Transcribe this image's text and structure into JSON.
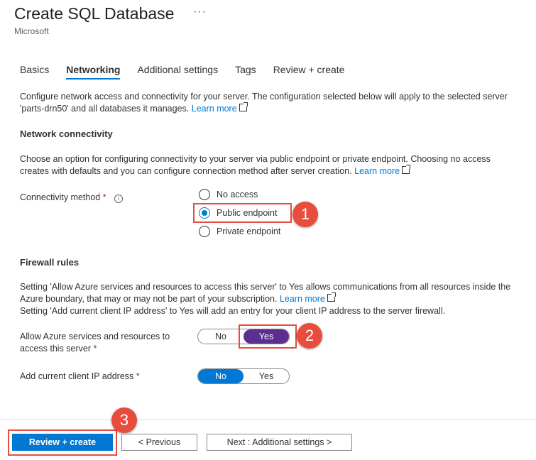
{
  "header": {
    "title": "Create SQL Database",
    "more": "···",
    "subtitle": "Microsoft"
  },
  "tabs": [
    {
      "label": "Basics",
      "active": false
    },
    {
      "label": "Networking",
      "active": true
    },
    {
      "label": "Additional settings",
      "active": false
    },
    {
      "label": "Tags",
      "active": false
    },
    {
      "label": "Review + create",
      "active": false
    }
  ],
  "intro": {
    "text": "Configure network access and connectivity for your server. The configuration selected below will apply to the selected server 'parts-drn50' and all databases it manages.",
    "link": "Learn more"
  },
  "network": {
    "heading": "Network connectivity",
    "description": "Choose an option for configuring connectivity to your server via public endpoint or private endpoint. Choosing no access creates with defaults and you can configure connection method after server creation.",
    "link": "Learn more",
    "method_label": "Connectivity method",
    "required_mark": "*",
    "info_glyph": "i",
    "options": [
      "No access",
      "Public endpoint",
      "Private endpoint"
    ],
    "selected": "Public endpoint"
  },
  "firewall": {
    "heading": "Firewall rules",
    "description1": "Setting 'Allow Azure services and resources to access this server' to Yes allows communications from all resources inside the Azure boundary, that may or may not be part of your subscription.",
    "link": "Learn more",
    "description2": "Setting 'Add current client IP address' to Yes will add an entry for your client IP address to the server firewall.",
    "allow_azure_label": "Allow Azure services and resources to access this server",
    "allow_azure_value": "Yes",
    "client_ip_label": "Add current client IP address",
    "client_ip_value": "No",
    "no_label": "No",
    "yes_label": "Yes",
    "required_mark": "*"
  },
  "footer": {
    "review_create": "Review + create",
    "previous": "< Previous",
    "next": "Next : Additional settings >"
  },
  "callouts": [
    "1",
    "2",
    "3"
  ],
  "colors": {
    "accent": "#0078d4",
    "toggle_on": "#5c2e91",
    "callout": "#e74c3c"
  }
}
